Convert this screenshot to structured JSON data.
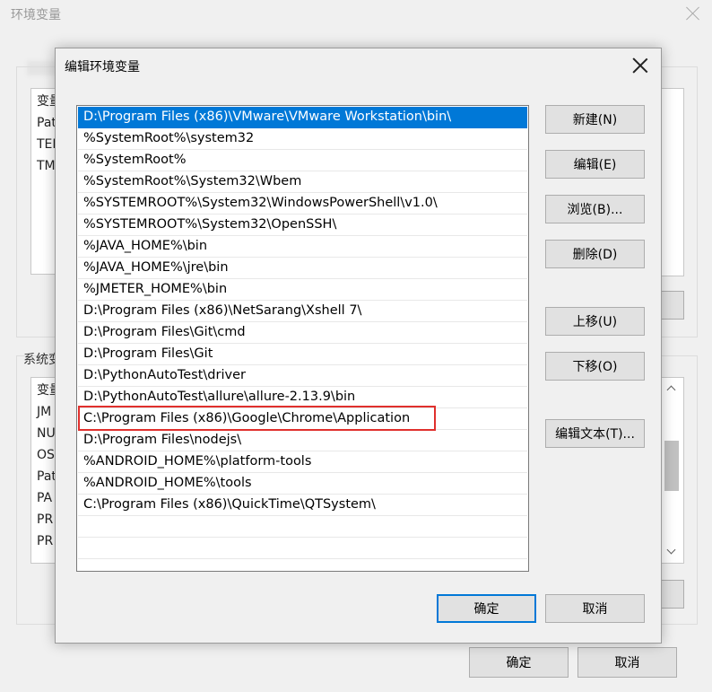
{
  "outer": {
    "title": "环境变量",
    "user_list_partial": [
      "变量",
      "Pat",
      "TEI",
      "TM"
    ],
    "system_group_label": "系统变",
    "system_list_partial": [
      "变量",
      "JM",
      "NU",
      "OS",
      "Pat",
      "PA",
      "PR",
      "PR"
    ],
    "ok_label": "确定",
    "cancel_label": "取消"
  },
  "dialog": {
    "title": "编辑环境变量",
    "paths": [
      "D:\\Program Files (x86)\\VMware\\VMware Workstation\\bin\\",
      "%SystemRoot%\\system32",
      "%SystemRoot%",
      "%SystemRoot%\\System32\\Wbem",
      "%SYSTEMROOT%\\System32\\WindowsPowerShell\\v1.0\\",
      "%SYSTEMROOT%\\System32\\OpenSSH\\",
      "%JAVA_HOME%\\bin",
      "%JAVA_HOME%\\jre\\bin",
      "%JMETER_HOME%\\bin",
      "D:\\Program Files (x86)\\NetSarang\\Xshell 7\\",
      "D:\\Program Files\\Git\\cmd",
      "D:\\Program Files\\Git",
      "D:\\PythonAutoTest\\driver",
      "D:\\PythonAutoTest\\allure\\allure-2.13.9\\bin",
      "C:\\Program Files (x86)\\Google\\Chrome\\Application",
      "D:\\Program Files\\nodejs\\",
      "%ANDROID_HOME%\\platform-tools",
      "%ANDROID_HOME%\\tools",
      "C:\\Program Files (x86)\\QuickTime\\QTSystem\\"
    ],
    "selected_index": 0,
    "highlighted_index": 14,
    "buttons": {
      "new": "新建(N)",
      "edit": "编辑(E)",
      "browse": "浏览(B)...",
      "delete": "删除(D)",
      "move_up": "上移(U)",
      "move_down": "下移(O)",
      "edit_text": "编辑文本(T)...",
      "ok": "确定",
      "cancel": "取消"
    }
  },
  "colors": {
    "selection": "#0078d7",
    "highlight_box": "#e0302d"
  }
}
